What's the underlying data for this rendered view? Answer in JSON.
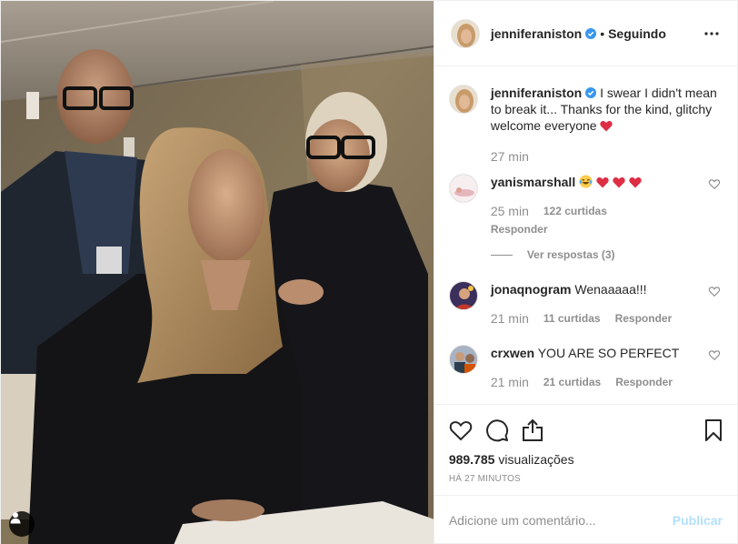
{
  "post": {
    "author": {
      "username": "jenniferaniston",
      "verified": true,
      "follow_state": "Seguindo",
      "separator": "•"
    },
    "caption": {
      "text": "I swear I didn't mean to break it... Thanks for the kind, glitchy welcome everyone",
      "emoji": "red-heart",
      "time": "27 min"
    },
    "comments": [
      {
        "username": "yanismarshall",
        "text": "",
        "emojis": [
          "laughing-tears",
          "red-heart",
          "red-heart",
          "red-heart"
        ],
        "time": "25 min",
        "likes": "122 curtidas",
        "reply_label": "Responder",
        "view_replies": "Ver respostas (3)"
      },
      {
        "username": "jonaqnogram",
        "text": "Wenaaaaa!!!",
        "time": "21 min",
        "likes": "11 curtidas",
        "reply_label": "Responder"
      },
      {
        "username": "crxwen",
        "text": "YOU ARE SO PERFECT",
        "time": "21 min",
        "likes": "21 curtidas",
        "reply_label": "Responder"
      }
    ],
    "actions": {
      "like_icon": "heart-outline-icon",
      "comment_icon": "comment-bubble-icon",
      "share_icon": "share-upload-icon",
      "save_icon": "bookmark-icon"
    },
    "views": {
      "count": "989.785",
      "label": "visualizações"
    },
    "time_ago": "HÁ 27 MINUTOS",
    "add_comment": {
      "placeholder": "Adicione um comentário...",
      "publish_label": "Publicar"
    }
  },
  "colors": {
    "verified_blue": "#3897f0",
    "heart_red": "#ed4956",
    "publish_disabled": "#b2dffc",
    "secondary_text": "#8e8e8e"
  }
}
